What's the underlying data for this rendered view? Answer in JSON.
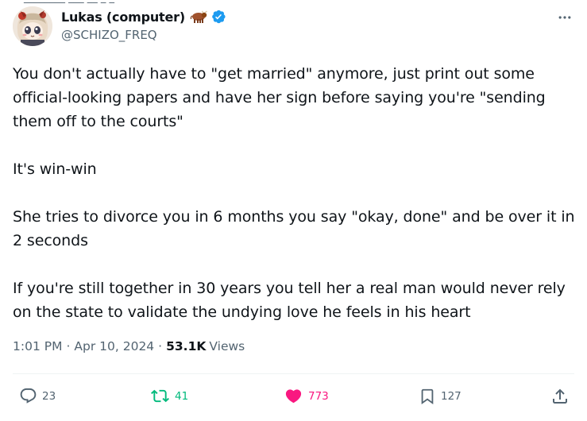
{
  "author": {
    "display_name": "Lukas (computer)",
    "handle": "@SCHIZO_FREQ",
    "avatar_icon": "anime-avatar",
    "name_emoji": "bull-emoji",
    "verified": true,
    "verified_color": "#1d9bf0"
  },
  "tweet": {
    "paragraphs": [
      "You don't actually have to \"get married\" anymore, just print out some\nofficial-looking papers and have her sign before saying you're \"sending\nthem off to the courts\"",
      "It's win-win",
      "She tries to divorce you in 6 months you say \"okay, done\" and be over it in\n2 seconds",
      "If you're still together in 30 years you tell her a real man would never rely\non the state to validate the undying love he feels in his heart"
    ]
  },
  "meta": {
    "time": "1:01 PM",
    "separator": "·",
    "date": "Apr 10, 2024",
    "views_count": "53.1K",
    "views_label": "Views"
  },
  "actions": {
    "replies": "23",
    "reposts": "41",
    "likes": "773",
    "bookmarks": "127"
  },
  "colors": {
    "text": "#0f1419",
    "secondary": "#536471",
    "repost_active": "#00ba7c",
    "like_active": "#f91880",
    "divider": "#eff3f4"
  }
}
